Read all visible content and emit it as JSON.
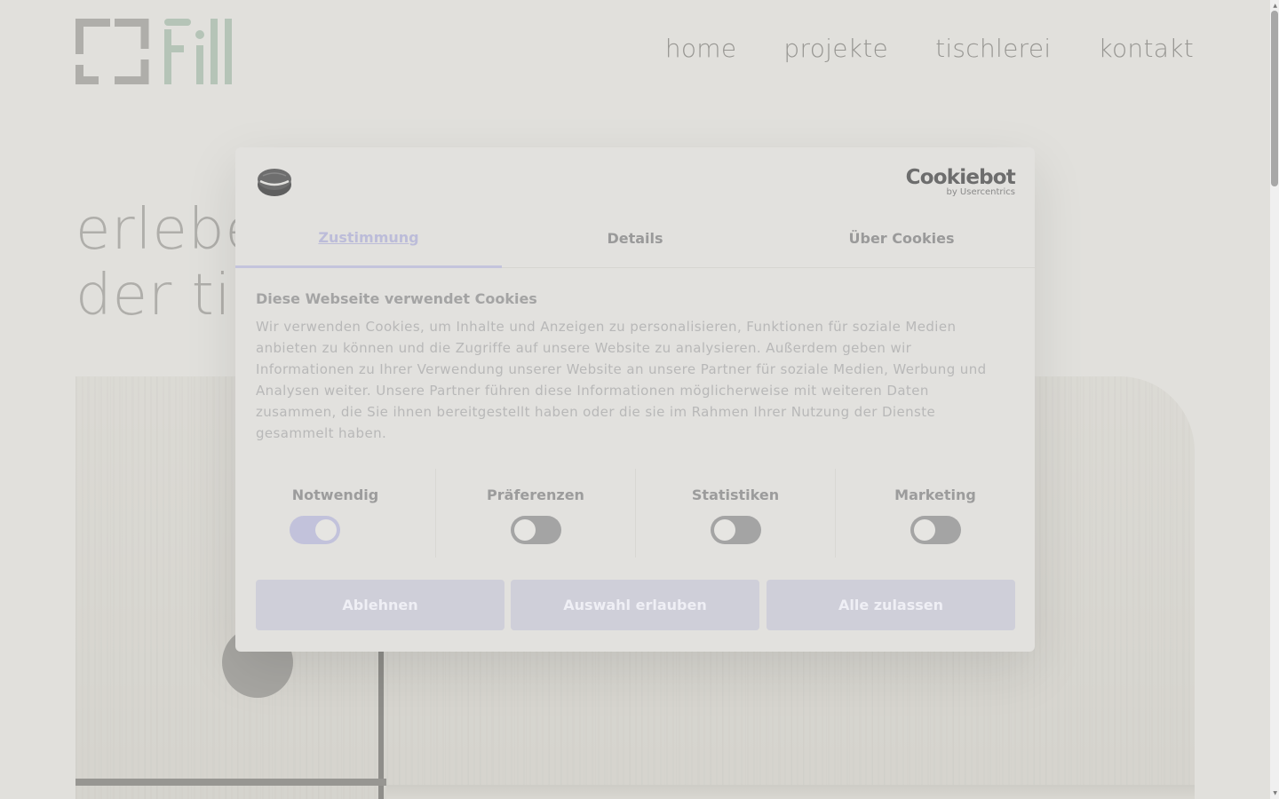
{
  "header": {
    "logo_text": "fill",
    "nav": [
      {
        "label": "home"
      },
      {
        "label": "projekte"
      },
      {
        "label": "tischlerei"
      },
      {
        "label": "kontakt"
      }
    ]
  },
  "hero": {
    "heading_line1": "erlebe",
    "heading_line2": "der tis"
  },
  "cookie_dialog": {
    "brand": {
      "name": "Cookiebot",
      "sub": "by Usercentrics"
    },
    "tabs": [
      {
        "label": "Zustimmung",
        "active": true
      },
      {
        "label": "Details",
        "active": false
      },
      {
        "label": "Über Cookies",
        "active": false
      }
    ],
    "title": "Diese Webseite verwendet Cookies",
    "description": "Wir verwenden Cookies, um Inhalte und Anzeigen zu personalisieren, Funktionen für soziale Medien anbieten zu können und die Zugriffe auf unsere Website zu analysieren. Außerdem geben wir Informationen zu Ihrer Verwendung unserer Website an unsere Partner für soziale Medien, Werbung und Analysen weiter. Unsere Partner führen diese Informationen möglicherweise mit weiteren Daten zusammen, die Sie ihnen bereitgestellt haben oder die sie im Rahmen Ihrer Nutzung der Dienste gesammelt haben.",
    "toggles": [
      {
        "label": "Notwendig",
        "on": true
      },
      {
        "label": "Präferenzen",
        "on": false
      },
      {
        "label": "Statistiken",
        "on": false
      },
      {
        "label": "Marketing",
        "on": false
      }
    ],
    "buttons": {
      "decline": "Ablehnen",
      "allow_selection": "Auswahl erlauben",
      "allow_all": "Alle zulassen"
    }
  },
  "colors": {
    "accent": "#c2c2db",
    "logo_gray": "#9a9a9a",
    "logo_green": "#a6c7b5"
  }
}
